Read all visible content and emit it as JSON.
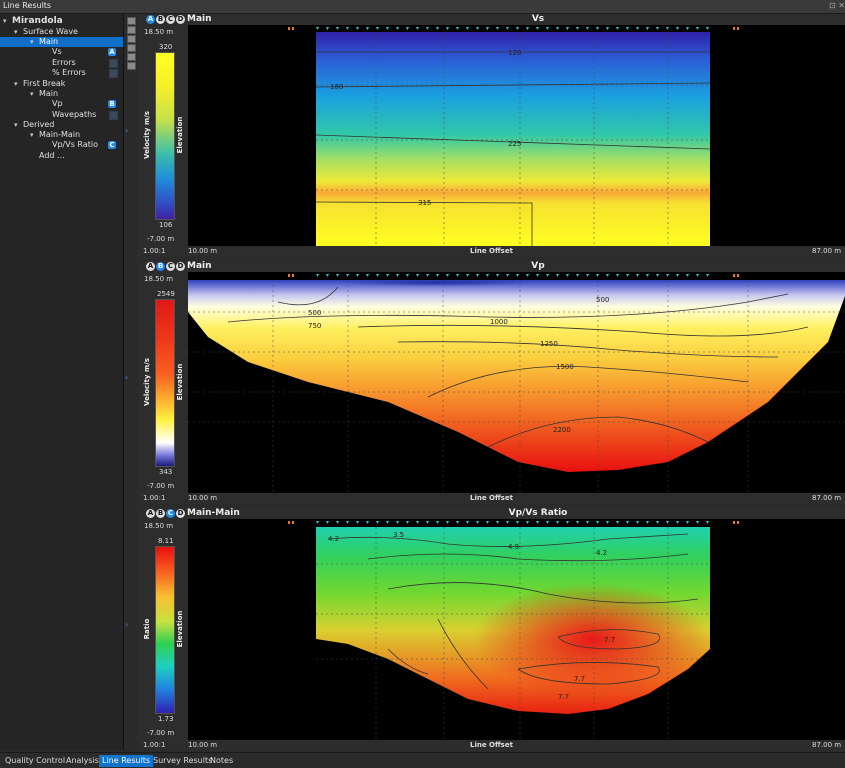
{
  "window": {
    "title": "Line Results",
    "controls": "⊡ ✕"
  },
  "tree": {
    "root": "Mirandola",
    "items": [
      {
        "label": "Surface Wave",
        "arrow": "▾"
      },
      {
        "label": "Main",
        "arrow": "▾"
      },
      {
        "label": "Vs",
        "arrow": "",
        "badge": "A"
      },
      {
        "label": "Errors",
        "arrow": ""
      },
      {
        "label": "% Errors",
        "arrow": ""
      },
      {
        "label": "First Break",
        "arrow": "▾"
      },
      {
        "label": "Main",
        "arrow": "▾"
      },
      {
        "label": "Vp",
        "arrow": "",
        "badge": "B"
      },
      {
        "label": "Wavepaths",
        "arrow": ""
      },
      {
        "label": "Derived",
        "arrow": "▾"
      },
      {
        "label": "Main-Main",
        "arrow": "▾"
      },
      {
        "label": "Vp/Vs Ratio",
        "arrow": "",
        "badge": "C"
      },
      {
        "label": "Add ...",
        "arrow": ""
      }
    ]
  },
  "panels": [
    {
      "letters": [
        "A",
        "B",
        "C",
        "D"
      ],
      "active": "A",
      "name": "Main",
      "title": "Vs",
      "elev_top": "18.50 m",
      "elev_bottom": "-7.00 m",
      "cb_max": "320",
      "cb_min": "106",
      "cb_label": "Velocity m/s",
      "elev_label": "Elevation",
      "scale": "1.00:1",
      "x_left": "10.00 m",
      "x_label": "Line Offset",
      "x_right": "87.00 m",
      "contours": [
        "120",
        "180",
        "225",
        "315"
      ]
    },
    {
      "letters": [
        "A",
        "B",
        "C",
        "D"
      ],
      "active": "B",
      "name": "Main",
      "title": "Vp",
      "elev_top": "18.50 m",
      "elev_bottom": "-7.00 m",
      "cb_max": "2549",
      "cb_min": "343",
      "cb_label": "Velocity m/s",
      "elev_label": "Elevation",
      "scale": "1.00:1",
      "x_left": "10.00 m",
      "x_label": "Line Offset",
      "x_right": "87.00 m",
      "contours": [
        "500",
        "750",
        "500",
        "1000",
        "1250",
        "1500",
        "2200"
      ]
    },
    {
      "letters": [
        "A",
        "B",
        "C",
        "D"
      ],
      "active": "C",
      "name": "Main-Main",
      "title": "Vp/Vs Ratio",
      "elev_top": "18.50 m",
      "elev_bottom": "-7.00 m",
      "cb_max": "8.11",
      "cb_min": "1.73",
      "cb_label": "Ratio",
      "elev_label": "Elevation",
      "scale": "1.00:1",
      "x_left": "10.00 m",
      "x_label": "Line Offset",
      "x_right": "87.00 m",
      "contours": [
        "4.2",
        "3.5",
        "4.9",
        "4.2",
        "7.7",
        "7.7",
        "7.7"
      ]
    }
  ],
  "tabs": [
    "Quality Control",
    "Analysis",
    "Line Results",
    "Survey Results",
    "Notes"
  ],
  "active_tab": "Line Results",
  "colors": {
    "accent": "#1173c9",
    "badge": "#1f8ae8",
    "background": "#2b2b2b"
  }
}
